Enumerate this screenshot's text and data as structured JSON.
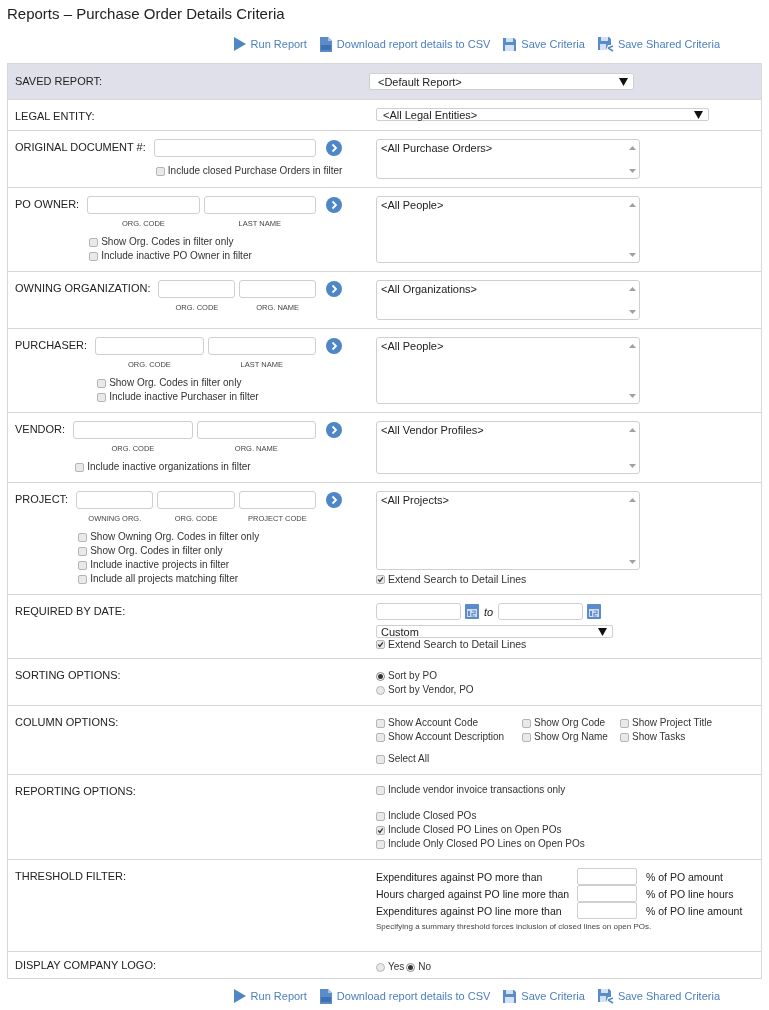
{
  "title": "Reports – Purchase Order Details Criteria",
  "toolbar_top": [
    {
      "kind": "run",
      "label": "Run Report"
    },
    {
      "kind": "csv",
      "label": "Download report details to CSV"
    },
    {
      "kind": "save",
      "label": "Save Criteria"
    },
    {
      "kind": "shared",
      "label": "Save Shared Criteria"
    }
  ],
  "sections": [
    {
      "kind": "select",
      "label": "SAVED REPORT:",
      "highlight": true,
      "value": "<Default Report>"
    },
    {
      "kind": "select",
      "label": "LEGAL ENTITY:",
      "highlight": false,
      "value": "<All Legal Entities>"
    },
    {
      "kind": "lookup",
      "label": "ORIGINAL DOCUMENT #:",
      "fields": [
        {
          "kind": "plain"
        }
      ],
      "checkboxes": [
        {
          "label": "Include closed Purchase Orders in filter",
          "checked": false
        }
      ],
      "list_item": "<All Purchase Orders>"
    },
    {
      "kind": "lookup",
      "label": "PO OWNER:",
      "fields": [
        {
          "kind": "captioned",
          "caption": "ORG. CODE"
        },
        {
          "kind": "captioned",
          "caption": "LAST NAME"
        }
      ],
      "checkboxes": [
        {
          "label": "Show Org. Codes in filter only",
          "checked": false
        },
        {
          "label": "Include inactive PO Owner in filter",
          "checked": false
        }
      ],
      "list_item": "<All People>"
    },
    {
      "kind": "lookup",
      "label": "OWNING ORGANIZATION:",
      "fields": [
        {
          "kind": "captioned",
          "caption": "ORG. CODE"
        },
        {
          "kind": "captioned",
          "caption": "ORG. NAME"
        }
      ],
      "list_item": "<All Organizations>"
    },
    {
      "kind": "lookup",
      "label": "PURCHASER:",
      "fields": [
        {
          "kind": "captioned",
          "caption": "ORG. CODE"
        },
        {
          "kind": "captioned",
          "caption": "LAST NAME"
        }
      ],
      "checkboxes": [
        {
          "label": "Show Org. Codes in filter only",
          "checked": false
        },
        {
          "label": "Include inactive Purchaser in filter",
          "checked": false
        }
      ],
      "list_item": "<All People>"
    },
    {
      "kind": "lookup",
      "label": "VENDOR:",
      "fields": [
        {
          "kind": "captioned",
          "caption": "ORG. CODE"
        },
        {
          "kind": "captioned",
          "caption": "ORG. NAME"
        }
      ],
      "checkboxes": [
        {
          "label": "Include inactive organizations in filter",
          "checked": false
        }
      ],
      "list_item": "<All Vendor Profiles>"
    },
    {
      "kind": "lookup",
      "label": "PROJECT:",
      "fields": [
        {
          "kind": "captioned",
          "caption": "OWNING ORG."
        },
        {
          "kind": "captioned",
          "caption": "ORG. CODE"
        },
        {
          "kind": "captioned",
          "caption": "PROJECT CODE"
        }
      ],
      "checkboxes": [
        {
          "label": "Show Owning Org. Codes in filter only",
          "checked": false
        },
        {
          "label": "Show Org. Codes in filter only",
          "checked": false
        },
        {
          "label": "Include inactive projects in filter",
          "checked": false
        },
        {
          "label": "Include all projects matching filter",
          "checked": false
        }
      ],
      "list_item": "<All Projects>",
      "extend": {
        "label": "Extend Search to Detail Lines",
        "checked": true
      }
    },
    {
      "kind": "date",
      "label": "REQUIRED BY DATE:",
      "separator": "to",
      "range": "Custom",
      "extend": {
        "label": "Extend Search to Detail Lines",
        "checked": true
      }
    },
    {
      "kind": "radio_list",
      "label": "SORTING OPTIONS:",
      "options": [
        {
          "label": "Sort by PO",
          "selected": true
        },
        {
          "label": "Sort by Vendor, PO",
          "selected": false
        }
      ]
    },
    {
      "kind": "columns",
      "label": "COLUMN OPTIONS:",
      "options": [
        {
          "label": "Show Account Code",
          "checked": false
        },
        {
          "label": "Show Org Code",
          "checked": false
        },
        {
          "label": "Show Project Title",
          "checked": false
        },
        {
          "label": "Show Account Description",
          "checked": false
        },
        {
          "label": "Show Org Name",
          "checked": false
        },
        {
          "label": "Show Tasks",
          "checked": false
        }
      ],
      "select_all": {
        "label": "Select All",
        "checked": false
      }
    },
    {
      "kind": "checkbox_groups",
      "label": "REPORTING OPTIONS:",
      "groups": [
        [
          {
            "label": "Include vendor invoice transactions only",
            "checked": false
          }
        ],
        [
          {
            "label": "Include Closed POs",
            "checked": false
          },
          {
            "label": "Include Closed PO Lines on Open POs",
            "checked": true
          },
          {
            "label": "Include Only Closed PO Lines on Open POs",
            "checked": false
          }
        ]
      ]
    },
    {
      "kind": "threshold",
      "label": "THRESHOLD FILTER:",
      "rows": [
        {
          "label": "Expenditures against PO more than",
          "suffix": "% of PO amount"
        },
        {
          "label": "Hours charged against PO line more than",
          "suffix": "% of PO line hours"
        },
        {
          "label": "Expenditures against PO line more than",
          "suffix": "% of PO line amount"
        }
      ],
      "note": "Specifying a summary threshold forces inclusion of closed lines on open POs."
    },
    {
      "kind": "radio_row",
      "label": "DISPLAY COMPANY LOGO:",
      "options": [
        {
          "label": "Yes",
          "selected": false
        },
        {
          "label": "No",
          "selected": true
        }
      ]
    }
  ],
  "toolbar_bottom": [
    {
      "kind": "run",
      "label": "Run Report"
    },
    {
      "kind": "csv",
      "label": "Download report details to CSV"
    },
    {
      "kind": "save",
      "label": "Save Criteria"
    },
    {
      "kind": "shared",
      "label": "Save Shared Criteria"
    }
  ]
}
